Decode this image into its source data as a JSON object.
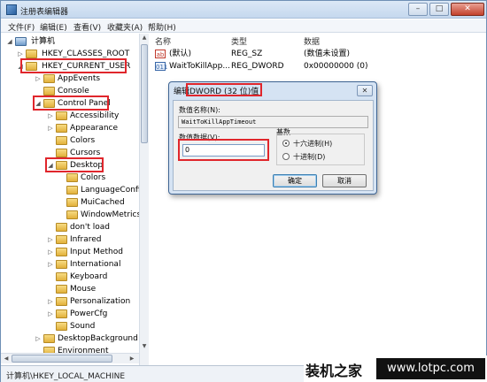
{
  "window": {
    "title": "注册表编辑器",
    "min_label": "–",
    "max_label": "□",
    "close_label": "✕"
  },
  "menu": [
    "文件(F)",
    "编辑(E)",
    "查看(V)",
    "收藏夹(A)",
    "帮助(H)"
  ],
  "tree": {
    "computer": "计算机",
    "classes_root": "HKEY_CLASSES_ROOT",
    "current_user": "HKEY_CURRENT_USER",
    "hkcu_children": [
      "AppEvents",
      "Console",
      "Control Panel"
    ],
    "control_panel_children": [
      "Accessibility",
      "Appearance",
      "Colors",
      "Cursors",
      "Desktop"
    ],
    "desktop_children": [
      "Colors",
      "LanguageConfig",
      "MuiCached",
      "WindowMetrics"
    ],
    "control_panel_more": [
      "don't load",
      "Infrared",
      "Input Method",
      "International",
      "Keyboard",
      "Mouse",
      "Personalization",
      "PowerCfg",
      "Sound"
    ],
    "hkcu_more": [
      "DesktopBackground",
      "Environment"
    ]
  },
  "list": {
    "headers": {
      "name": "名称",
      "type": "类型",
      "data": "数据"
    },
    "rows": [
      {
        "icon": "string-value-icon",
        "badge": "ab",
        "name": "(默认)",
        "type": "REG_SZ",
        "data": "(数值未设置)"
      },
      {
        "icon": "dword-value-icon",
        "badge": "011",
        "name": "WaitToKillApp...",
        "type": "REG_DWORD",
        "data": "0x00000000 (0)"
      }
    ]
  },
  "statusbar": {
    "path": "计算机\\HKEY_LOCAL_MACHINE"
  },
  "dialog": {
    "title_prefix": "编辑",
    "title_highlight": "DWORD (32 位)值",
    "close_label": "✕",
    "value_name_label": "数值名称(N):",
    "value_name": "WaitToKillAppTimeout",
    "value_data_label": "数值数据(V):",
    "value_data": "0",
    "base_label": "基数",
    "hex_label": "十六进制(H)",
    "dec_label": "十进制(D)",
    "selected_base": "hex",
    "ok_label": "确定",
    "cancel_label": "取消"
  },
  "watermark": {
    "brand": "装机之家",
    "url": "www.lotpc.com"
  },
  "colors": {
    "highlight_box": "#e0262c",
    "title_bar": "#c5d8ee"
  }
}
